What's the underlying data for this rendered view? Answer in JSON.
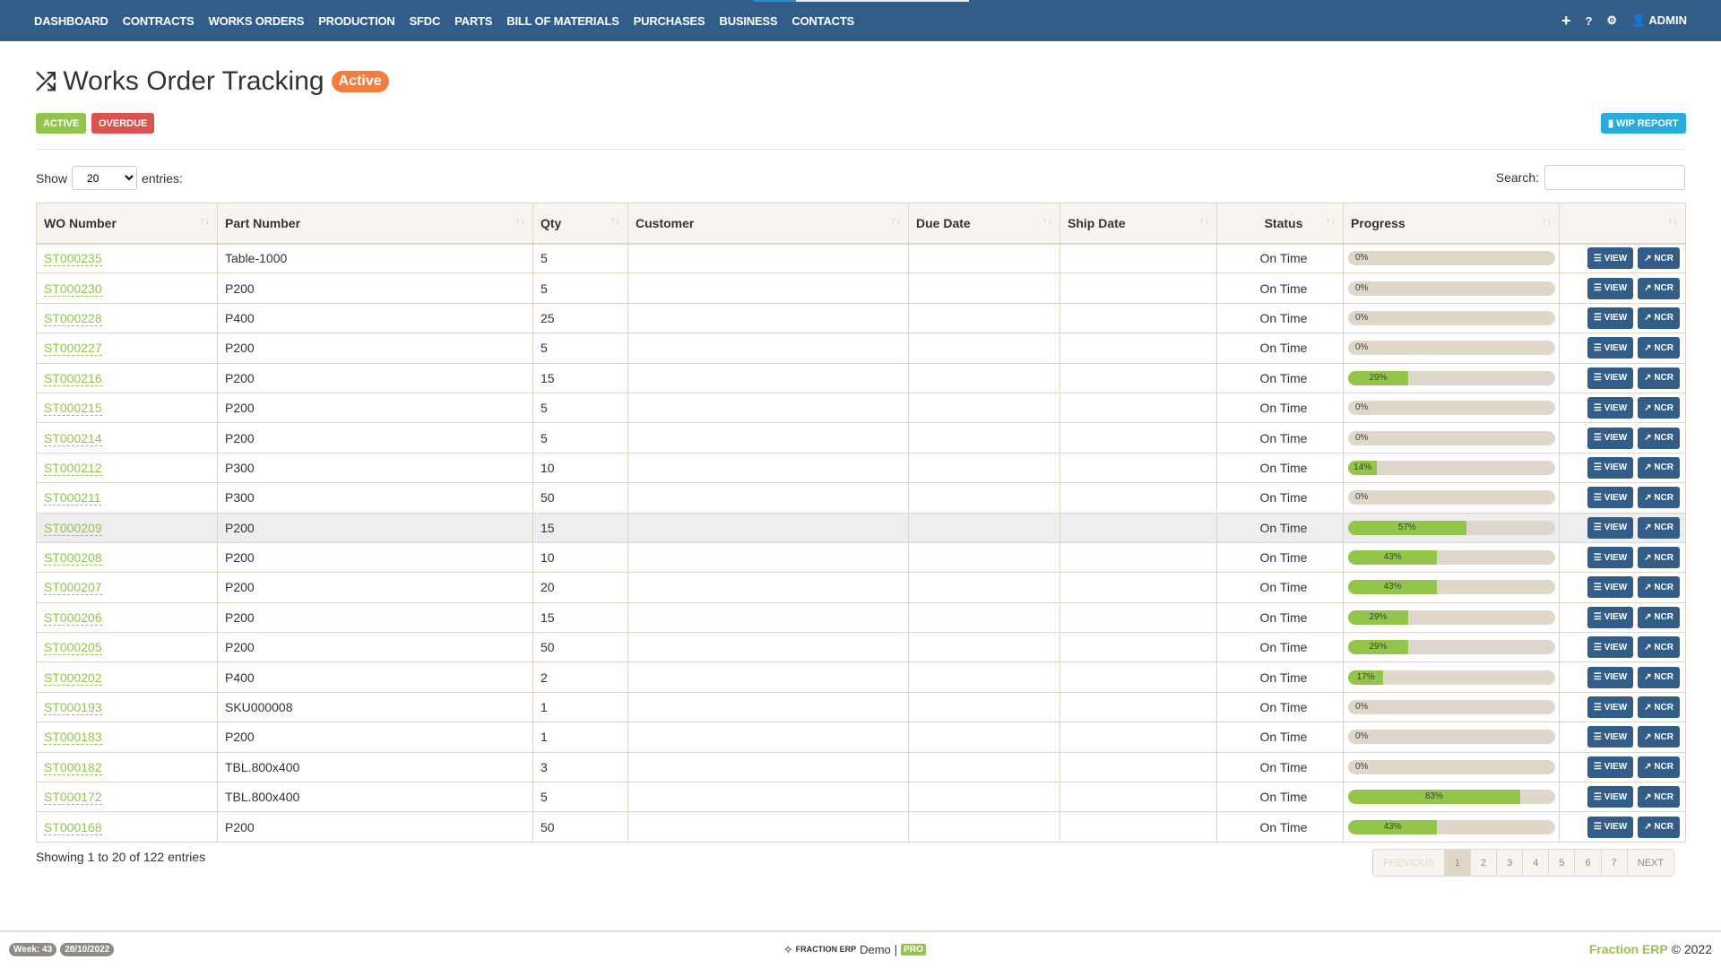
{
  "nav": {
    "items": [
      "DASHBOARD",
      "CONTRACTS",
      "WORKS ORDERS",
      "PRODUCTION",
      "SFDC",
      "PARTS",
      "BILL OF MATERIALS",
      "PURCHASES",
      "BUSINESS",
      "CONTACTS"
    ],
    "user": "ADMIN"
  },
  "header": {
    "title": "Works Order Tracking",
    "badge": "Active",
    "filter_active": "ACTIVE",
    "filter_overdue": "OVERDUE",
    "wip_report": "WIP REPORT"
  },
  "controls": {
    "show_label": "Show",
    "entries_value": "20",
    "entries_label": "entries:",
    "search_label": "Search:",
    "search_value": ""
  },
  "table": {
    "headers": [
      "WO Number",
      "Part Number",
      "Qty",
      "Customer",
      "Due Date",
      "Ship Date",
      "Status",
      "Progress",
      ""
    ],
    "view_label": "VIEW",
    "ncr_label": "NCR",
    "rows": [
      {
        "wo": "ST000235",
        "part": "Table-1000",
        "qty": "5",
        "customer": "",
        "due": "",
        "ship": "",
        "status": "On Time",
        "progress": 0,
        "progress_label": "0%"
      },
      {
        "wo": "ST000230",
        "part": "P200",
        "qty": "5",
        "customer": "",
        "due": "",
        "ship": "",
        "status": "On Time",
        "progress": 0,
        "progress_label": "0%"
      },
      {
        "wo": "ST000228",
        "part": "P400",
        "qty": "25",
        "customer": "",
        "due": "",
        "ship": "",
        "status": "On Time",
        "progress": 0,
        "progress_label": "0%"
      },
      {
        "wo": "ST000227",
        "part": "P200",
        "qty": "5",
        "customer": "",
        "due": "",
        "ship": "",
        "status": "On Time",
        "progress": 0,
        "progress_label": "0%"
      },
      {
        "wo": "ST000216",
        "part": "P200",
        "qty": "15",
        "customer": "",
        "due": "",
        "ship": "",
        "status": "On Time",
        "progress": 29,
        "progress_label": "29%"
      },
      {
        "wo": "ST000215",
        "part": "P200",
        "qty": "5",
        "customer": "",
        "due": "",
        "ship": "",
        "status": "On Time",
        "progress": 0,
        "progress_label": "0%"
      },
      {
        "wo": "ST000214",
        "part": "P200",
        "qty": "5",
        "customer": "",
        "due": "",
        "ship": "",
        "status": "On Time",
        "progress": 0,
        "progress_label": "0%"
      },
      {
        "wo": "ST000212",
        "part": "P300",
        "qty": "10",
        "customer": "",
        "due": "",
        "ship": "",
        "status": "On Time",
        "progress": 14,
        "progress_label": "14%"
      },
      {
        "wo": "ST000211",
        "part": "P300",
        "qty": "50",
        "customer": "",
        "due": "",
        "ship": "",
        "status": "On Time",
        "progress": 0,
        "progress_label": "0%"
      },
      {
        "wo": "ST000209",
        "part": "P200",
        "qty": "15",
        "customer": "",
        "due": "",
        "ship": "",
        "status": "On Time",
        "progress": 57,
        "progress_label": "57%",
        "highlighted": true
      },
      {
        "wo": "ST000208",
        "part": "P200",
        "qty": "10",
        "customer": "",
        "due": "",
        "ship": "",
        "status": "On Time",
        "progress": 43,
        "progress_label": "43%"
      },
      {
        "wo": "ST000207",
        "part": "P200",
        "qty": "20",
        "customer": "",
        "due": "",
        "ship": "",
        "status": "On Time",
        "progress": 43,
        "progress_label": "43%"
      },
      {
        "wo": "ST000206",
        "part": "P200",
        "qty": "15",
        "customer": "",
        "due": "",
        "ship": "",
        "status": "On Time",
        "progress": 29,
        "progress_label": "29%"
      },
      {
        "wo": "ST000205",
        "part": "P200",
        "qty": "50",
        "customer": "",
        "due": "",
        "ship": "",
        "status": "On Time",
        "progress": 29,
        "progress_label": "29%"
      },
      {
        "wo": "ST000202",
        "part": "P400",
        "qty": "2",
        "customer": "",
        "due": "",
        "ship": "",
        "status": "On Time",
        "progress": 17,
        "progress_label": "17%"
      },
      {
        "wo": "ST000193",
        "part": "SKU000008",
        "qty": "1",
        "customer": "",
        "due": "",
        "ship": "",
        "status": "On Time",
        "progress": 0,
        "progress_label": "0%"
      },
      {
        "wo": "ST000183",
        "part": "P200",
        "qty": "1",
        "customer": "",
        "due": "",
        "ship": "",
        "status": "On Time",
        "progress": 0,
        "progress_label": "0%"
      },
      {
        "wo": "ST000182",
        "part": "TBL.800x400",
        "qty": "3",
        "customer": "",
        "due": "",
        "ship": "",
        "status": "On Time",
        "progress": 0,
        "progress_label": "0%"
      },
      {
        "wo": "ST000172",
        "part": "TBL.800x400",
        "qty": "5",
        "customer": "",
        "due": "",
        "ship": "",
        "status": "On Time",
        "progress": 83,
        "progress_label": "83%"
      },
      {
        "wo": "ST000168",
        "part": "P200",
        "qty": "50",
        "customer": "",
        "due": "",
        "ship": "",
        "status": "On Time",
        "progress": 43,
        "progress_label": "43%"
      }
    ]
  },
  "pagination": {
    "info": "Showing 1 to 20 of 122 entries",
    "previous": "PREVIOUS",
    "pages": [
      "1",
      "2",
      "3",
      "4",
      "5",
      "6",
      "7"
    ],
    "current": "1",
    "next": "NEXT"
  },
  "footer": {
    "week": "Week: 43",
    "date": "28/10/2022",
    "brand_small": "FRACTION ERP",
    "demo": "Demo",
    "separator": "|",
    "pro": "PRO",
    "copyright_brand": "Fraction ERP",
    "copyright": "© 2022"
  },
  "colors": {
    "nav": "#325d88",
    "accent": "#93c54b",
    "orange": "#f47c3c",
    "danger": "#d9534f",
    "info": "#29abe0"
  }
}
